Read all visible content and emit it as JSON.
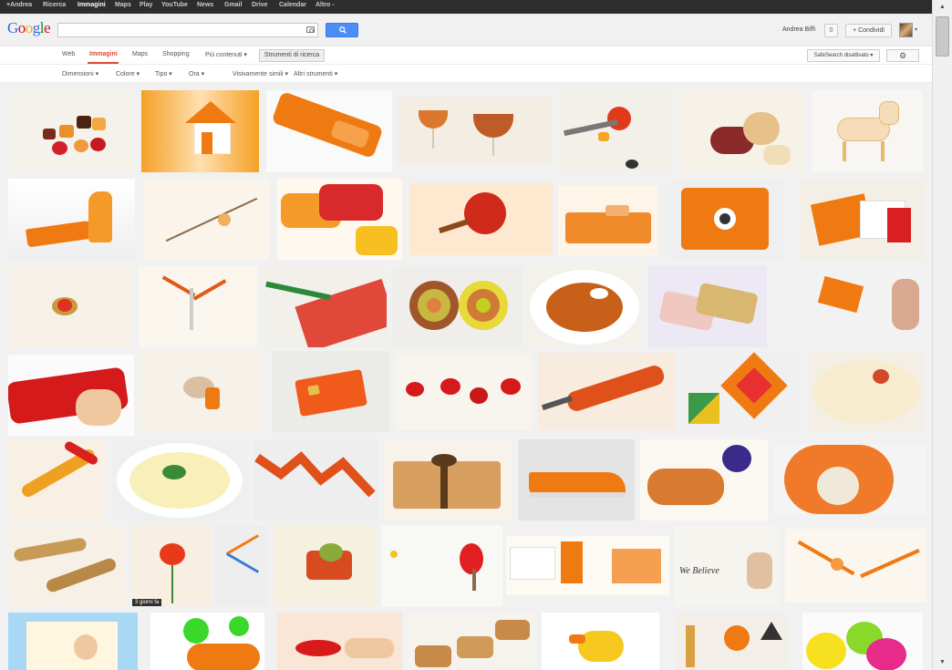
{
  "gbar": {
    "items": [
      {
        "label": "+Andrea",
        "active": false
      },
      {
        "label": "Ricerca",
        "active": false
      },
      {
        "label": "Immagini",
        "active": true
      },
      {
        "label": "Maps",
        "active": false
      },
      {
        "label": "Play",
        "active": false
      },
      {
        "label": "YouTube",
        "active": false
      },
      {
        "label": "News",
        "active": false
      },
      {
        "label": "Gmail",
        "active": false
      },
      {
        "label": "Drive",
        "active": false
      },
      {
        "label": "Calendar",
        "active": false
      },
      {
        "label": "Altro -",
        "active": false
      }
    ]
  },
  "header": {
    "logo_letters": [
      {
        "char": "G",
        "color": "#3369e8"
      },
      {
        "char": "o",
        "color": "#d50f25"
      },
      {
        "char": "o",
        "color": "#eeb211"
      },
      {
        "char": "g",
        "color": "#3369e8"
      },
      {
        "char": "l",
        "color": "#009925"
      },
      {
        "char": "e",
        "color": "#d50f25"
      }
    ],
    "search_value": "",
    "user_name": "Andrea Biffi",
    "notification_count": "0",
    "share_label": "+ Condividi",
    "avatar_caret": "▾"
  },
  "nav": {
    "tabs": [
      {
        "label": "Web",
        "active": false
      },
      {
        "label": "Immagini",
        "active": true
      },
      {
        "label": "Maps",
        "active": false
      },
      {
        "label": "Shopping",
        "active": false
      },
      {
        "label": "Più contenuti ▾",
        "active": false
      }
    ],
    "tools_label": "Strumenti di ricerca",
    "safesearch_label": "SafeSearch disattivato ▾",
    "settings_icon": "gear-icon"
  },
  "filters": [
    {
      "label": "Dimensioni ▾"
    },
    {
      "label": "Colore ▾"
    },
    {
      "label": "Tipo ▾"
    },
    {
      "label": "Ora ▾"
    },
    {
      "label": "Visivamente simili ▾"
    },
    {
      "label": "Altri strumenti ▾"
    }
  ],
  "results": {
    "background": "#f1f1f1",
    "accent": "#f57c1f",
    "thumbnails": [
      {
        "name": "candies"
      },
      {
        "name": "orange-house"
      },
      {
        "name": "orange-phone"
      },
      {
        "name": "cocktail-glasses"
      },
      {
        "name": "tomato-tongs"
      },
      {
        "name": "baby"
      },
      {
        "name": "glass-dog"
      },
      {
        "name": "orange-heel"
      },
      {
        "name": "branch-flower"
      },
      {
        "name": "orange-bowls"
      },
      {
        "name": "pomegranate"
      },
      {
        "name": "orange-bed"
      },
      {
        "name": "orange-ipad-case"
      },
      {
        "name": "orange-book"
      },
      {
        "name": "coral-ring"
      },
      {
        "name": "orange-clips"
      },
      {
        "name": "pencil-ruler"
      },
      {
        "name": "target-circles"
      },
      {
        "name": "soup-plate"
      },
      {
        "name": "gold-iphones"
      },
      {
        "name": "girl-kite"
      },
      {
        "name": "red-towel-hand"
      },
      {
        "name": "shell-ring"
      },
      {
        "name": "orange-sim-card"
      },
      {
        "name": "red-roses"
      },
      {
        "name": "screwdriver"
      },
      {
        "name": "tangram"
      },
      {
        "name": "soup-herbs"
      },
      {
        "name": "orange-ribbon"
      },
      {
        "name": "cream-plate"
      },
      {
        "name": "zigzag"
      },
      {
        "name": "wooden-box"
      },
      {
        "name": "orange-sneaker"
      },
      {
        "name": "wooden-toy"
      },
      {
        "name": "orange-girl"
      },
      {
        "name": "horns"
      },
      {
        "name": "poppy",
        "badge": "3 giorni fa"
      },
      {
        "name": "straws"
      },
      {
        "name": "cabbage-box"
      },
      {
        "name": "ping-pong"
      },
      {
        "name": "orange-notebooks"
      },
      {
        "name": "we-believe",
        "script": "We Believe"
      },
      {
        "name": "paper-straws"
      },
      {
        "name": "girl-cartoon"
      },
      {
        "name": "green-dots"
      },
      {
        "name": "hand-kiss"
      },
      {
        "name": "tartlets"
      },
      {
        "name": "duck-toy"
      },
      {
        "name": "geometric"
      },
      {
        "name": "colored-eggs"
      }
    ]
  },
  "scrollbar": {
    "up": "▲",
    "down": "▼"
  }
}
